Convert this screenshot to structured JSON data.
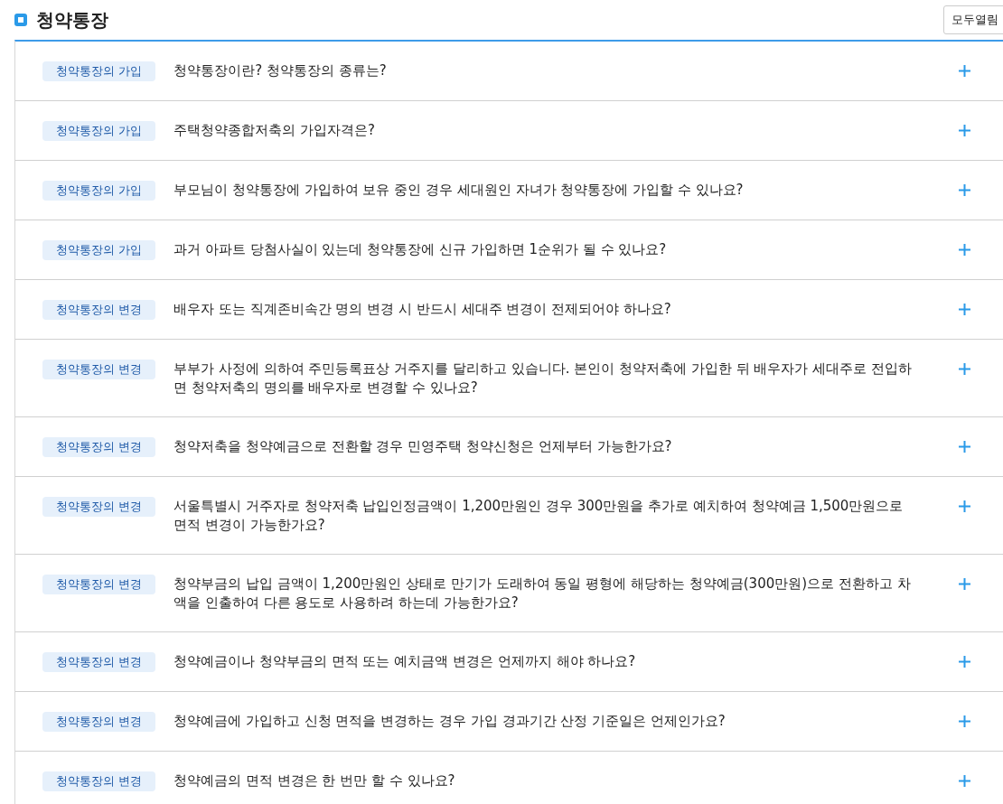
{
  "section": {
    "title": "청약통장",
    "expand_all_button": "모두열림"
  },
  "faq_items": [
    {
      "category": "청약통장의 가입",
      "question": "청약통장이란? 청약통장의 종류는?"
    },
    {
      "category": "청약통장의 가입",
      "question": "주택청약종합저축의 가입자격은?"
    },
    {
      "category": "청약통장의 가입",
      "question": "부모님이 청약통장에 가입하여 보유 중인 경우 세대원인 자녀가 청약통장에 가입할 수 있나요?"
    },
    {
      "category": "청약통장의 가입",
      "question": "과거 아파트 당첨사실이 있는데 청약통장에 신규 가입하면 1순위가 될 수 있나요?"
    },
    {
      "category": "청약통장의 변경",
      "question": "배우자 또는 직계존비속간 명의 변경 시 반드시 세대주 변경이 전제되어야 하나요?"
    },
    {
      "category": "청약통장의 변경",
      "question": "부부가 사정에 의하여 주민등록표상 거주지를 달리하고 있습니다. 본인이 청약저축에 가입한 뒤 배우자가 세대주로 전입하면 청약저축의 명의를 배우자로 변경할 수 있나요?"
    },
    {
      "category": "청약통장의 변경",
      "question": "청약저축을 청약예금으로 전환할 경우 민영주택 청약신청은 언제부터 가능한가요?"
    },
    {
      "category": "청약통장의 변경",
      "question": "서울특별시 거주자로 청약저축 납입인정금액이 1,200만원인 경우 300만원을 추가로 예치하여 청약예금 1,500만원으로 면적 변경이 가능한가요?"
    },
    {
      "category": "청약통장의 변경",
      "question": "청약부금의 납입 금액이 1,200만원인 상태로 만기가 도래하여 동일 평형에 해당하는 청약예금(300만원)으로 전환하고 차액을 인출하여 다른 용도로 사용하려 하는데 가능한가요?"
    },
    {
      "category": "청약통장의 변경",
      "question": "청약예금이나 청약부금의 면적 또는 예치금액 변경은 언제까지 해야 하나요?"
    },
    {
      "category": "청약통장의 변경",
      "question": "청약예금에 가입하고 신청 면적을 변경하는 경우 가입 경과기간 산정 기준일은 언제인가요?"
    },
    {
      "category": "청약통장의 변경",
      "question": "청약예금의 면적 변경은 한 번만 할 수 있나요?"
    }
  ]
}
